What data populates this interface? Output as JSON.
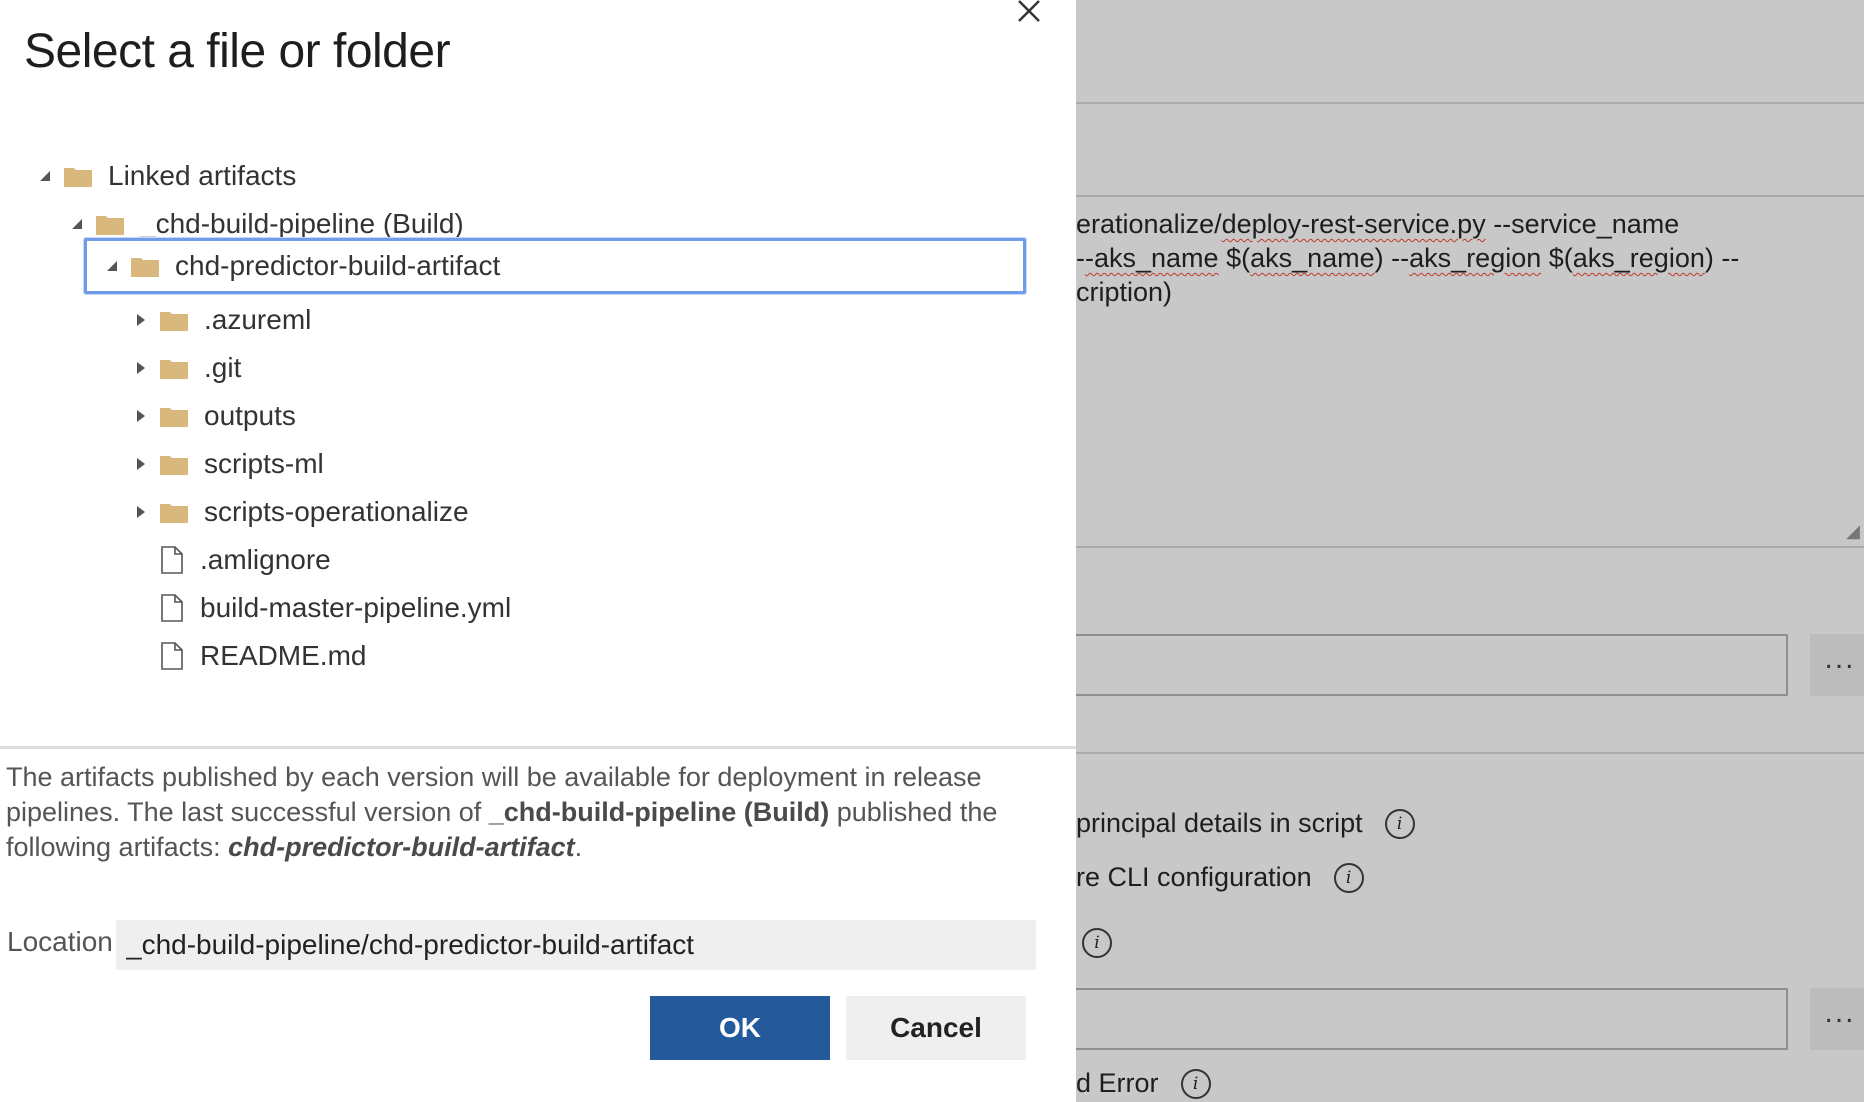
{
  "dialog": {
    "title": "Select a file or folder",
    "tree": {
      "root": "Linked artifacts",
      "pipeline": "_chd-build-pipeline (Build)",
      "artifact": "chd-predictor-build-artifact",
      "folders": [
        ".azureml",
        ".git",
        "outputs",
        "scripts-ml",
        "scripts-operationalize"
      ],
      "files": [
        ".amlignore",
        "build-master-pipeline.yml",
        "README.md"
      ]
    },
    "description": {
      "part1": "The artifacts published by each version will be available for deployment in release pipelines. The last successful version of ",
      "pipeline_bold": "_chd-build-pipeline (Build)",
      "part2": " published the following artifacts: ",
      "artifact_italic": "chd-predictor-build-artifact",
      "part3": "."
    },
    "location": {
      "label": "Location",
      "value": "_chd-build-pipeline/chd-predictor-build-artifact"
    },
    "ok_label": "OK",
    "cancel_label": "Cancel"
  },
  "background": {
    "script_line1_a": "erationalize/",
    "script_line1_link": "deploy-rest-service.py",
    "script_line1_b": " --service_name",
    "script_line2_a": "-",
    "script_line2_sq1": "-aks_name",
    "script_line2_b": " $(",
    "script_line2_sq2": "aks_name",
    "script_line2_c": ") --",
    "script_line2_sq3": "aks_region",
    "script_line2_d": " $(",
    "script_line2_sq4": "aks_region",
    "script_line2_e": ") --",
    "script_line3": "cription)",
    "more_label": "...",
    "option1": "principal details in script",
    "option2": "re CLI configuration",
    "option4": "d Error"
  },
  "colors": {
    "ok_bg": "#245a9c",
    "selected_border": "#6f9be8",
    "folder": "#d9b77d",
    "overlay_bg": "#c8c8c8"
  }
}
